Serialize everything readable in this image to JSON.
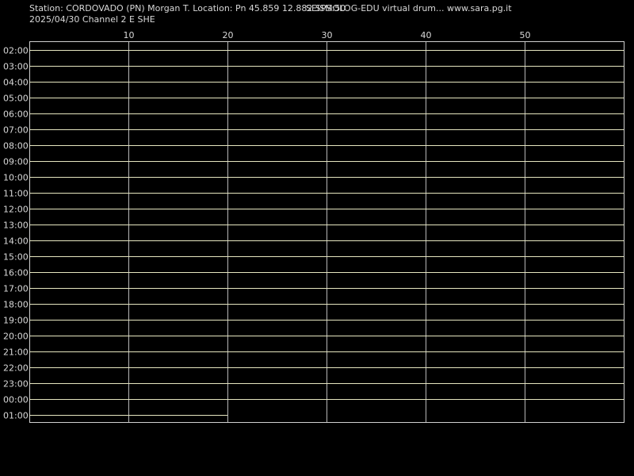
{
  "header": {
    "station": "Station: CORDOVADO (PN) Morgan T. Location: Pn 45.859 12.882 SPS:50",
    "app": "SEISMOLOG-EDU virtual drum... www.sara.pg.it",
    "date_channel": "2025/04/30  Channel 2 E SHE"
  },
  "colors": {
    "background": "#000000",
    "text": "#d8d8d8",
    "grid": "#b8b8b8",
    "trace": "#e6e6c0"
  },
  "chart_data": {
    "type": "line",
    "xlabel": "",
    "ylabel": "",
    "xlim": [
      0,
      60
    ],
    "x_ticks": [
      10,
      20,
      30,
      40,
      50
    ],
    "grid": "vertical at each x tick",
    "rows": [
      "02:00",
      "03:00",
      "04:00",
      "05:00",
      "06:00",
      "07:00",
      "08:00",
      "09:00",
      "10:00",
      "11:00",
      "12:00",
      "13:00",
      "14:00",
      "15:00",
      "16:00",
      "17:00",
      "18:00",
      "19:00",
      "20:00",
      "21:00",
      "22:00",
      "23:00",
      "00:00",
      "01:00"
    ],
    "row_extent_minutes": [
      60,
      60,
      60,
      60,
      60,
      60,
      60,
      60,
      60,
      60,
      60,
      60,
      60,
      60,
      60,
      60,
      60,
      60,
      60,
      60,
      60,
      60,
      60,
      20
    ],
    "amplitude": "flat"
  }
}
